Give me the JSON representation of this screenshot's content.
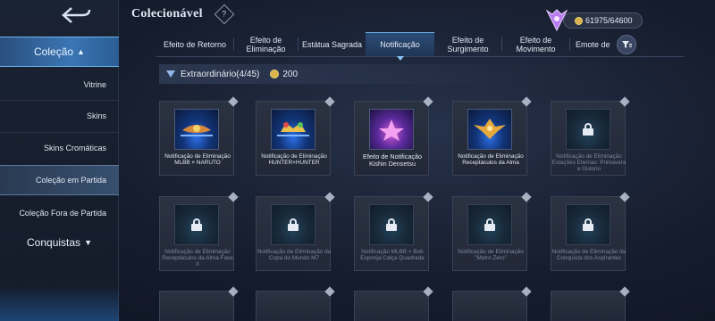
{
  "header": {
    "title": "Colecionável",
    "help_icon": "?",
    "progress": "61975/64600"
  },
  "sidebar": {
    "collection_label": "Coleção",
    "items": [
      {
        "label": "Vitrine"
      },
      {
        "label": "Skins"
      },
      {
        "label": "Skins Cromáticas"
      },
      {
        "label": "Coleção em Partida"
      },
      {
        "label": "Coleção Fora de Partida"
      }
    ],
    "achievements_label": "Conquistas"
  },
  "tabs": [
    {
      "label": "Efeito de Retorno"
    },
    {
      "label": "Efeito de Eliminação"
    },
    {
      "label": "Estátua Sagrada"
    },
    {
      "label": "Notificação"
    },
    {
      "label": "Efeito de Surgimento"
    },
    {
      "label": "Efeito de Movimento"
    },
    {
      "label": "Emote de"
    }
  ],
  "section": {
    "title": "Extraordinário(4/45)",
    "cost": "200"
  },
  "cards": [
    {
      "label": "Notificação de Eliminação MLBB × NARUTO",
      "locked": false
    },
    {
      "label": "Notificação de Eliminação HUNTER×HUNTER",
      "locked": false
    },
    {
      "label": "Efeito de Notificação Kishin Densetsu",
      "locked": false
    },
    {
      "label": "Notificação de Eliminação Receptáculos da Alma",
      "locked": false
    },
    {
      "label": "Notificação de Eliminação Estações Eternas: Primavera e Outono",
      "locked": true
    },
    {
      "label": "Notificação de Eliminação Receptáculos da Alma Fase II",
      "locked": true
    },
    {
      "label": "Notificação de Eliminação da Copa do Mundo M7",
      "locked": true
    },
    {
      "label": "Notificação MLBB × Bob Esponja Calça Quadrada",
      "locked": true
    },
    {
      "label": "Notificação de Eliminação \"Metro Zero\"",
      "locked": true
    },
    {
      "label": "Notificação de Eliminação da Conquista dos Aspirantes",
      "locked": true
    }
  ],
  "colors": {
    "accent": "#3b76b4",
    "coin": "#d9b24a"
  }
}
